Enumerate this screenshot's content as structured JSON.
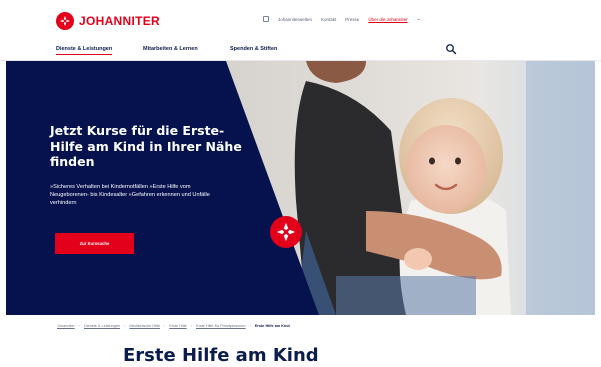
{
  "header": {
    "logo_text": "JOHANNITER",
    "utility_links": [
      "Johanniterwelten",
      "Kontakt",
      "Presse"
    ],
    "region_link": "Über die Johanniter"
  },
  "nav": {
    "items": [
      "Dienste & Leistungen",
      "Mitarbeiten & Lernen",
      "Spenden & Stiften"
    ]
  },
  "hero": {
    "title": "Jetzt Kurse für die Erste-Hilfe am Kind in Ihrer Nähe finden",
    "bullets": "»Sicheres Verhalten bei Kindernotfällen »Erste Hilfe vom Neugeborenen- bis Kindesalter »Gefahren erkennen und Unfälle verhindern",
    "button_label": "Zur Kurssuche"
  },
  "breadcrumb": {
    "items": [
      "Johanniter",
      "Dienste & Leistungen",
      "Medizinische Hilfe",
      "Erste Hilfe",
      "Erste Hilfe für Privatpersonen"
    ],
    "current": "Erste Hilfe am Kind"
  },
  "page": {
    "title": "Erste Hilfe am Kind"
  },
  "colors": {
    "brand_red": "#e2001a",
    "navy": "#05124e"
  }
}
